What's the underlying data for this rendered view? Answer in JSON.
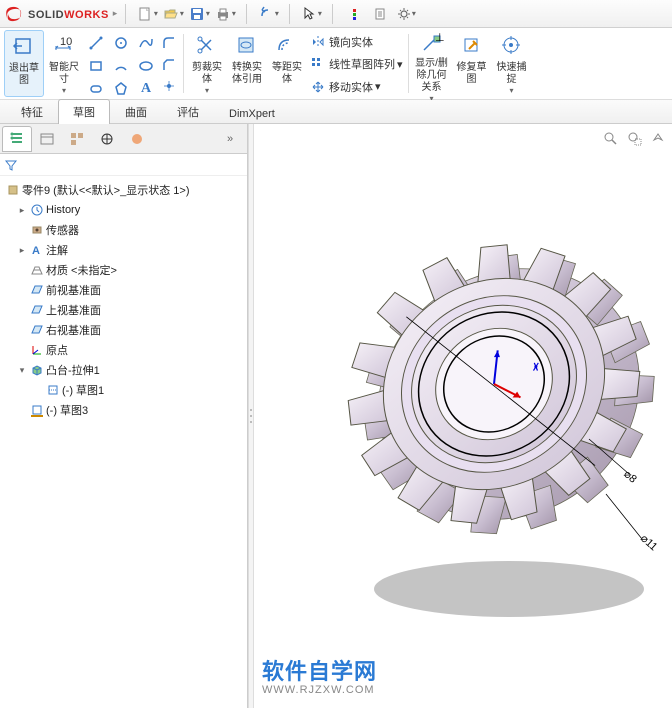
{
  "app": {
    "name_solid": "SOLID",
    "name_works": "WORKS"
  },
  "ribbon": {
    "exit_sketch": "退出草\n图",
    "smart_dim": "智能尺\n寸",
    "trim": "剪裁实\n体",
    "convert": "转换实\n体引用",
    "offset": "等距实\n体",
    "mirror": "镜向实体",
    "linear_pattern": "线性草图阵列",
    "move": "移动实体",
    "show_hide": "显示/删\n除几何\n关系",
    "repair": "修复草\n图",
    "quick_snap": "快速捕\n捉"
  },
  "tabs": [
    "特征",
    "草图",
    "曲面",
    "评估",
    "DimXpert"
  ],
  "active_tab": 1,
  "tree": {
    "root": "零件9 (默认<<默认>_显示状态 1>)",
    "items": [
      {
        "label": "History",
        "level": 1,
        "exp": true,
        "icon": "history"
      },
      {
        "label": "传感器",
        "level": 1,
        "icon": "sensor"
      },
      {
        "label": "注解",
        "level": 1,
        "exp": true,
        "icon": "annotation"
      },
      {
        "label": "材质 <未指定>",
        "level": 1,
        "icon": "material"
      },
      {
        "label": "前视基准面",
        "level": 1,
        "icon": "plane"
      },
      {
        "label": "上视基准面",
        "level": 1,
        "icon": "plane"
      },
      {
        "label": "右视基准面",
        "level": 1,
        "icon": "plane"
      },
      {
        "label": "原点",
        "level": 1,
        "icon": "origin"
      },
      {
        "label": "凸台-拉伸1",
        "level": 1,
        "exp": true,
        "open": true,
        "icon": "extrude"
      },
      {
        "label": "(-) 草图1",
        "level": 2,
        "icon": "sketch"
      },
      {
        "label": "(-) 草图3",
        "level": 1,
        "icon": "sketch-under"
      }
    ]
  },
  "dimensions": {
    "d1": "⌀8",
    "d2": "⌀11"
  },
  "watermark": {
    "title": "软件自学网",
    "url": "WWW.RJZXW.COM"
  }
}
